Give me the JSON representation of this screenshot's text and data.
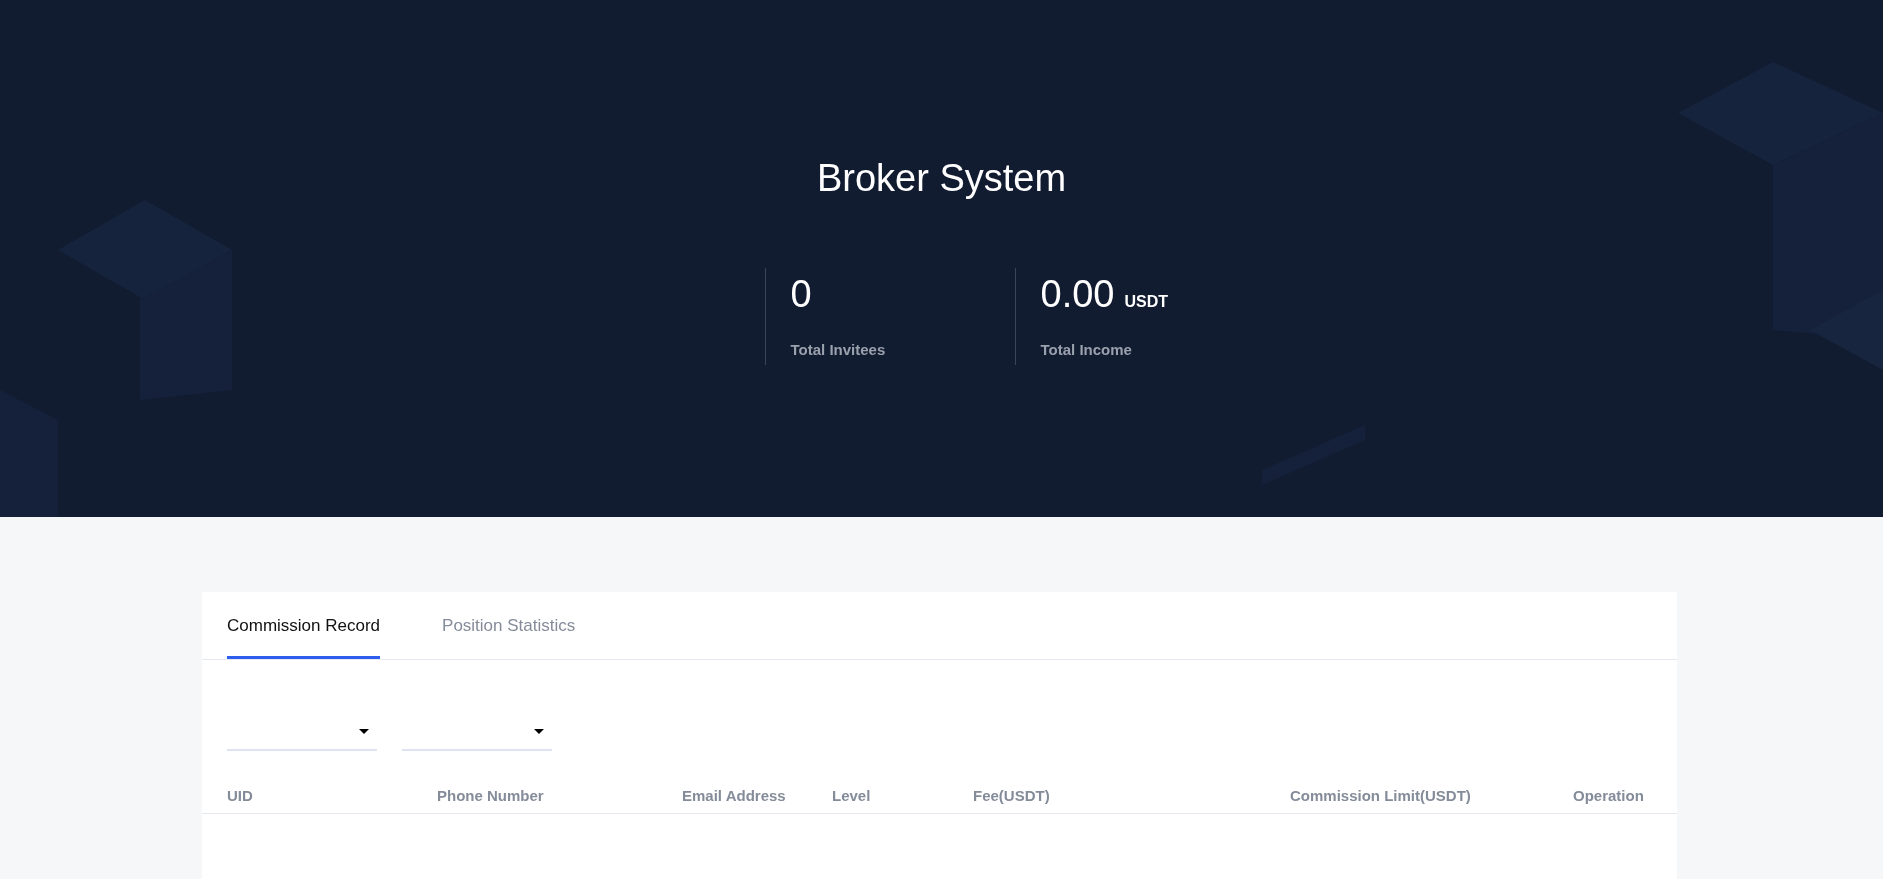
{
  "hero": {
    "title": "Broker System",
    "stats": [
      {
        "value": "0",
        "label": "Total Invitees"
      },
      {
        "value": "0.00",
        "unit": "USDT",
        "label": "Total Income"
      }
    ]
  },
  "tabs": [
    {
      "label": "Commission Record",
      "selected": true
    },
    {
      "label": "Position Statistics",
      "selected": false
    }
  ],
  "filters": [
    {
      "kind": "dropdown"
    },
    {
      "kind": "dropdown"
    }
  ],
  "table": {
    "columns": [
      "UID",
      "Phone Number",
      "Email Address",
      "Level",
      "Fee(USDT)",
      "Commission Limit(USDT)",
      "Operation"
    ]
  }
}
